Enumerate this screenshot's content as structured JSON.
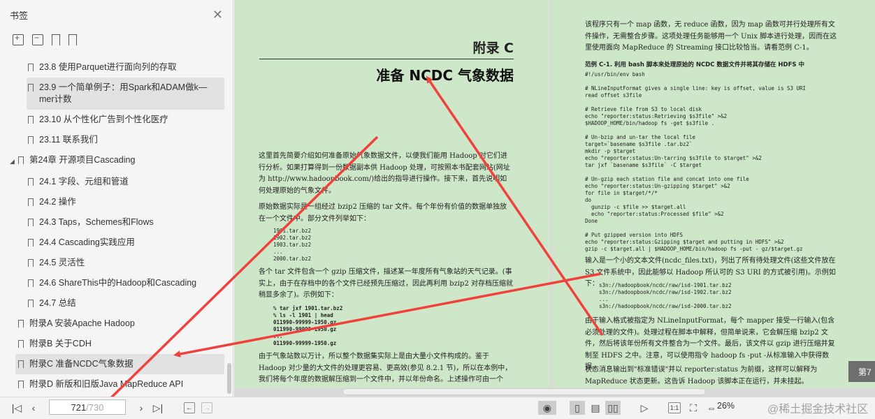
{
  "sidebar": {
    "title": "书签",
    "items": [
      {
        "label": "23.8 使用Parquet进行面向列的存取"
      },
      {
        "label": "23.9 一个简单例子：用Spark和ADAM做k—mer计数"
      },
      {
        "label": "23.10 从个性化广告到个性化医疗"
      },
      {
        "label": "23.11 联系我们"
      },
      {
        "label": "第24章 开源项目Cascading"
      },
      {
        "label": "24.1 字段、元组和管道"
      },
      {
        "label": "24.2 操作"
      },
      {
        "label": "24.3 Taps，Schemes和Flows"
      },
      {
        "label": "24.4 Cascading实践应用"
      },
      {
        "label": "24.5 灵活性"
      },
      {
        "label": "24.6 ShareThis中的Hadoop和Cascading"
      },
      {
        "label": "24.7 总结"
      },
      {
        "label": "附录A 安装Apache Hadoop"
      },
      {
        "label": "附录B 关于CDH"
      },
      {
        "label": "附录C 准备NCDC气象数据"
      },
      {
        "label": "附录D 新版和旧版Java MapReduce API"
      }
    ]
  },
  "document": {
    "left": {
      "appendix": "附录 C",
      "title": "准备 NCDC 气象数据",
      "p1": "这里首先简要介绍如何准备原始气象数据文件，以便我们能用 Hadoop 对它们进行分析。如果打算得到一份数据副本供 Hadoop 处理，可按照本书配套网站(网址为 http://www.hadoopbook.com/)给出的指导进行操作。接下来，首先说明如何处理原始的气象文件。",
      "p2": "原始数据实际是一组经过 bzip2 压缩的 tar 文件。每个年份有价值的数据单独放在一个文件中。部分文件列举如下：",
      "code1": "1901.tar.bz2\n1902.tar.bz2\n1903.tar.bz2\n...\n2000.tar.bz2",
      "p3": "各个 tar 文件包含一个 gzip 压缩文件，描述某一年度所有气象站的天气记录。(事实上，由于在存档中的各个文件已经预先压缩过，因此再利用 bzip2 对存档压缩就稍显多余了)。示例如下：",
      "code2": "% tar jxf 1901.tar.bz2\n% ls -l 1901 | head\n011990-99999-1950.gz\n011990-99999-1950.gz\n...\n011990-99999-1950.gz",
      "p4": "由于气象站数以万计，所以整个数据集实际上是由大量小文件构成的。鉴于 Hadoop 对少量的大文件的处理更容易、更高效(参见 8.2.1 节)，所以在本例中，我们将每个年度的数据解压缩到一个文件中，并以年份命名。上述操作可由一个"
    },
    "right": {
      "p1": "该程序只有一个 map 函数，无 reduce 函数，因为 map 函数可并行处理所有文件操作，无需整合步骤。这项处理任务能够用一个 Unix 脚本进行处理，因而在这里使用面向 MapReduce 的 Streaming 接口比较恰当。请看范例 C-1。",
      "caption": "范例 C-1. 利用 bash 脚本来处理原始的 NCDC 数据文件并将其存储在 HDFS 中",
      "code": "#!/usr/bin/env bash\n\n# NLineInputFormat gives a single line: key is offset, value is S3 URI\nread offset s3file\n\n# Retrieve file from S3 to local disk\necho \"reporter:status:Retrieving $s3file\" >&2\n$HADOOP_HOME/bin/hadoop fs -get $s3file .\n\n# Un-bzip and un-tar the local file\ntarget=`basename $s3file .tar.bz2`\nmkdir -p $target\necho \"reporter:status:Un-tarring $s3file to $target\" >&2\ntar jxf `basename $s3file` -C $target\n\n# Un-gzip each station file and concat into one file\necho \"reporter:status:Un-gzipping $target\" >&2\nfor file in $target/*/*\ndo\n  gunzip -c $file >> $target.all\n  echo \"reporter:status:Processed $file\" >&2\nDone\n\n# Put gzipped version into HDFS\necho \"reporter:status:Gzipping $target and putting in HDFS\" >&2\ngzip -c $target.all | $HADOOP_HOME/bin/hadoop fs -put - gz/$target.gz",
      "p2": "输入是一个小的文本文件(ncdc_files.txt)，列出了所有待处理文件(这些文件放在 S3 文件系统中，因此能够以 Hadoop 所认可的 S3 URI 的方式被引用)。示例如下：",
      "code2": "s3n://hadoopbook/ncdc/raw/isd-1901.tar.bz2\ns3n://hadoopbook/ncdc/raw/isd-1902.tar.bz2\n...\ns3n://hadoopbook/ncdc/raw/isd-2000.tar.bz2",
      "p3": "由于输入格式被指定为 NLineInputFormat，每个 mapper 接受一行输入(包含必须处理的文件)。处理过程在脚本中解释，但简单说来，它会解压缩 bzip2 文件，然后将该年份所有文件整合为一个文件。最后，该文件以 gzip 进行压缩并复制至 HDFS 之中。注意，可以使用指令 hadoop fs -put -从标准输入中获得数据。",
      "p4": "状态消息输出到\"标准错误\"并以 reporter:status 为前缀，这样可以解释为 MapReduce 状态更新。这告诉 Hadoop 该脚本正在运行，并未挂起。"
    },
    "page_badge": "第7"
  },
  "toolbar": {
    "current_page": "721",
    "total_pages": "/730",
    "zoom": "26%",
    "watermark": "@稀土掘金技术社区"
  },
  "colors": {
    "page": "#cfe7c9",
    "arrow": "#f0413c",
    "selected": "#e2e2e2"
  }
}
